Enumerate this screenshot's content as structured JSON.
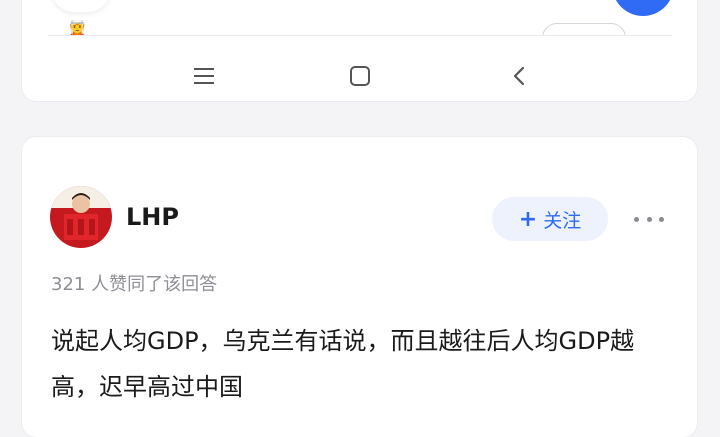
{
  "nav": {
    "menu_icon": "menu-icon",
    "home_icon": "home-icon",
    "back_icon": "back-icon"
  },
  "answer_card": {
    "author_name": "LHP",
    "follow_label": "关注",
    "likes_text": "321 人赞同了该回答",
    "content": "说起人均GDP，乌克兰有话说，而且越往后人均GDP越高，迟早高过中国"
  },
  "colors": {
    "accent": "#2f6bf4",
    "follow_bg": "#eef2fd",
    "muted_text": "#8e8e96"
  }
}
